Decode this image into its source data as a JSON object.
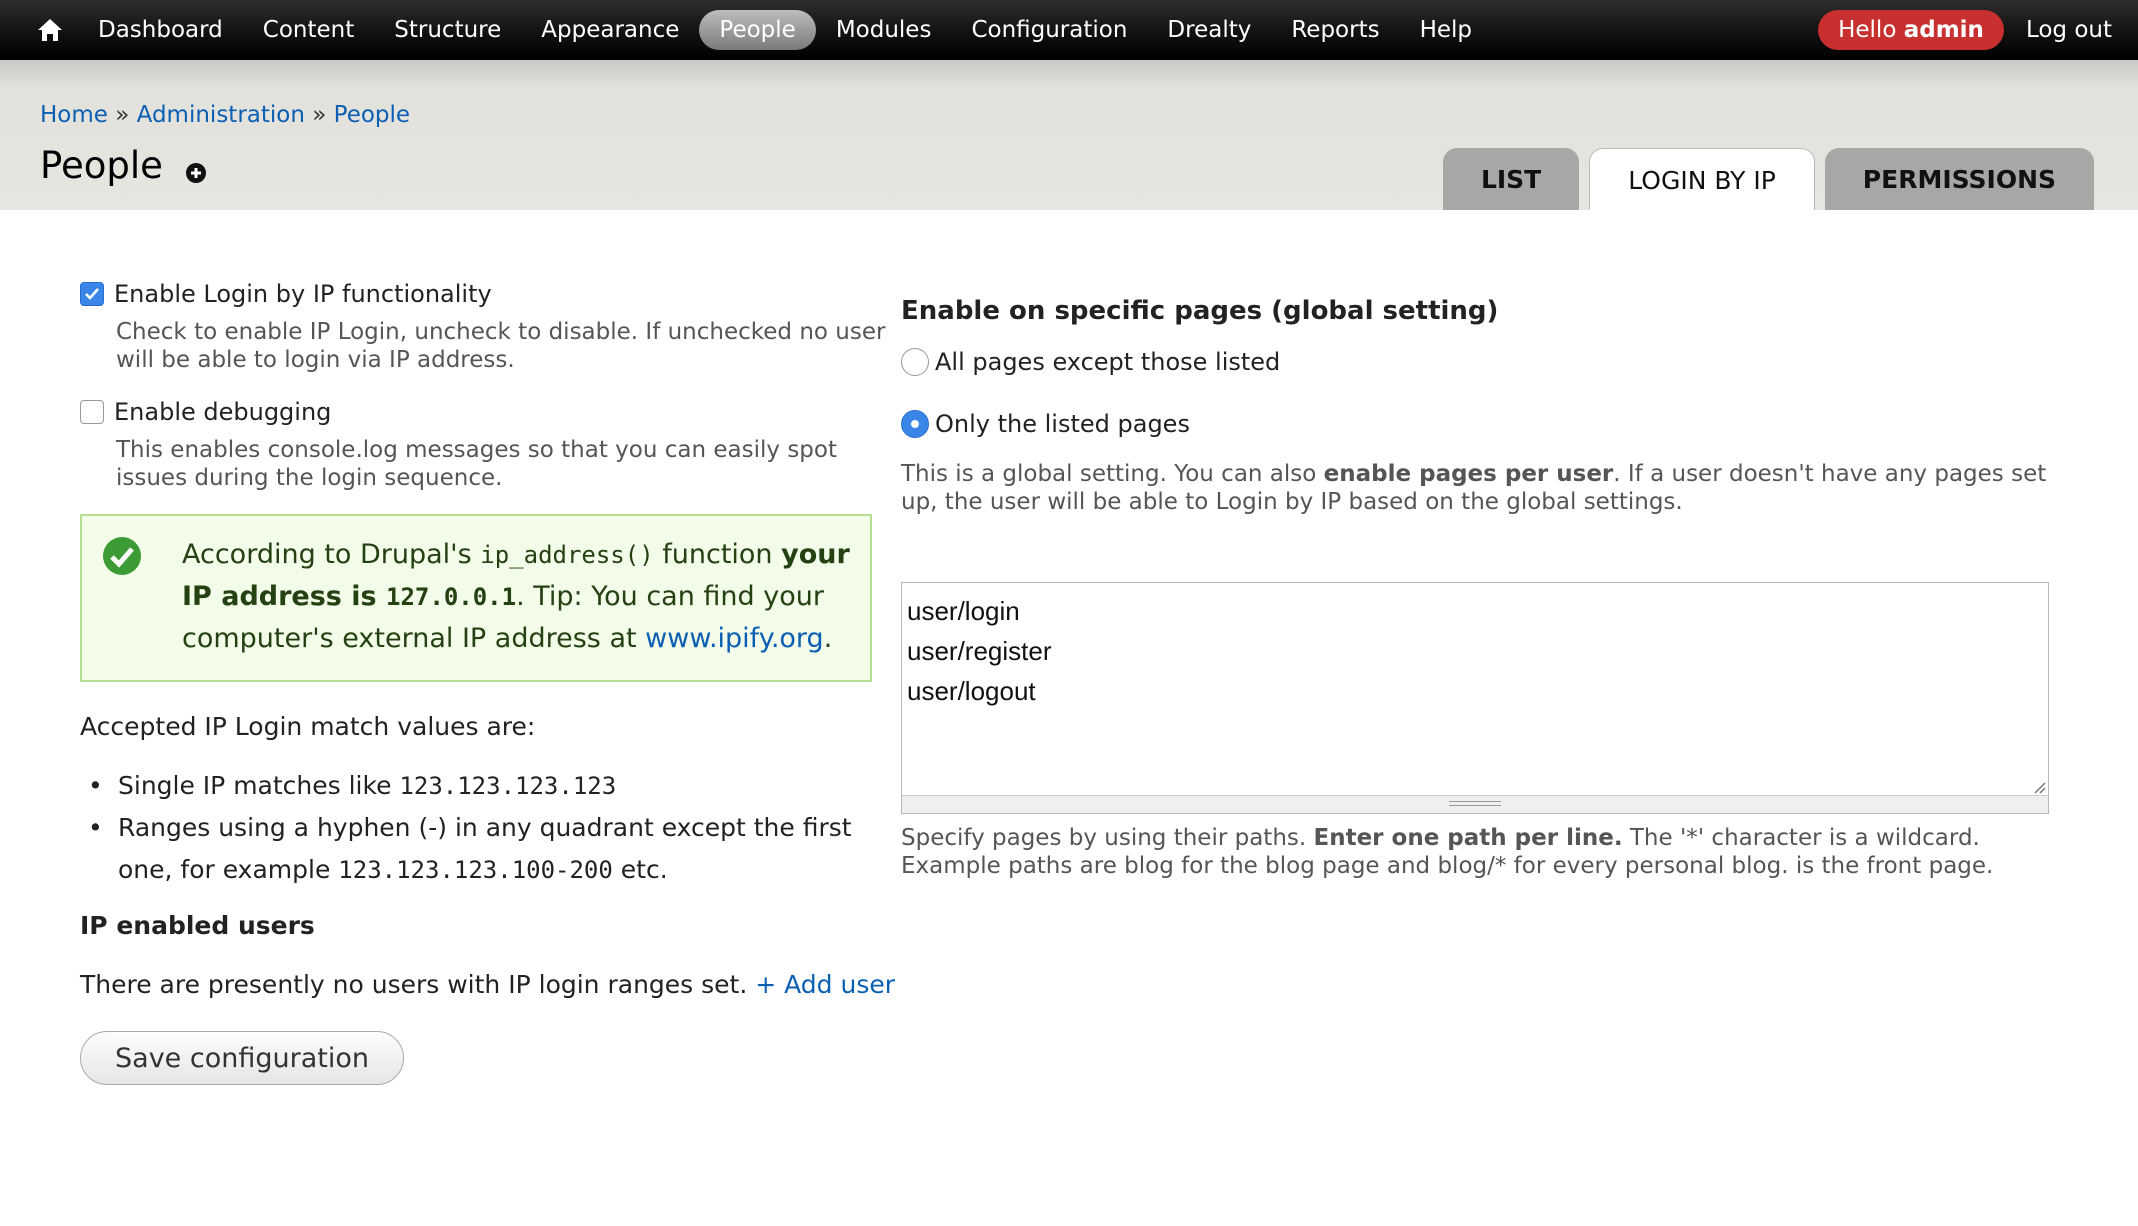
{
  "toolbar": {
    "items": [
      {
        "label": "Dashboard"
      },
      {
        "label": "Content"
      },
      {
        "label": "Structure"
      },
      {
        "label": "Appearance"
      },
      {
        "label": "People"
      },
      {
        "label": "Modules"
      },
      {
        "label": "Configuration"
      },
      {
        "label": "Drealty"
      },
      {
        "label": "Reports"
      },
      {
        "label": "Help"
      }
    ],
    "active": "People",
    "hello_prefix": "Hello",
    "hello_user": "admin",
    "logout": "Log out"
  },
  "breadcrumb": {
    "home": "Home",
    "sep": "»",
    "administration": "Administration",
    "people": "People"
  },
  "page_title": "People",
  "tabs": [
    {
      "label": "LIST"
    },
    {
      "label": "LOGIN BY IP"
    },
    {
      "label": "PERMISSIONS"
    }
  ],
  "left": {
    "enable_label": "Enable Login by IP functionality",
    "enable_desc": "Check to enable IP Login, uncheck to disable. If unchecked no user will be able to login via IP address.",
    "debug_label": "Enable debugging",
    "debug_desc": "This enables console.log messages so that you can easily spot issues during the login sequence.",
    "msg": {
      "p1": "According to Drupal's ",
      "func": "ip_address()",
      "p2": " function ",
      "bold1": "your IP address is ",
      "ip": "127.0.0.1",
      "p3": ". Tip: You can find your computer's external IP address at ",
      "link": "www.ipify.org",
      "p4": "."
    },
    "accepted": "Accepted IP Login match values are:",
    "bullet1_text": "Single IP matches like ",
    "bullet1_code": "123.123.123.123",
    "bullet2_text": "Ranges using a hyphen (-) in any quadrant except the first one, for example ",
    "bullet2_code": "123.123.123.100-200",
    "bullet2_end": " etc.",
    "ip_users_title": "IP enabled users",
    "no_users": "There are presently no users with IP login ranges set. ",
    "add_user": "+ Add user",
    "save": "Save configuration"
  },
  "right": {
    "title": "Enable on specific pages (global setting)",
    "radio1": "All pages except those listed",
    "radio2": "Only the listed pages",
    "desc_p1": "This is a global setting. You can also ",
    "desc_bold": "enable pages per user",
    "desc_p2": ". If a user doesn't have any pages set up, the user will be able to Login by IP based on the global settings.",
    "paths": [
      "user/login",
      "user/register",
      "user/logout"
    ],
    "help_p1": "Specify pages by using their paths. ",
    "help_bold": "Enter one path per line.",
    "help_p2": " The '*' character is a wildcard. Example paths are blog for the blog page and blog/* for every personal blog. is the front page."
  }
}
